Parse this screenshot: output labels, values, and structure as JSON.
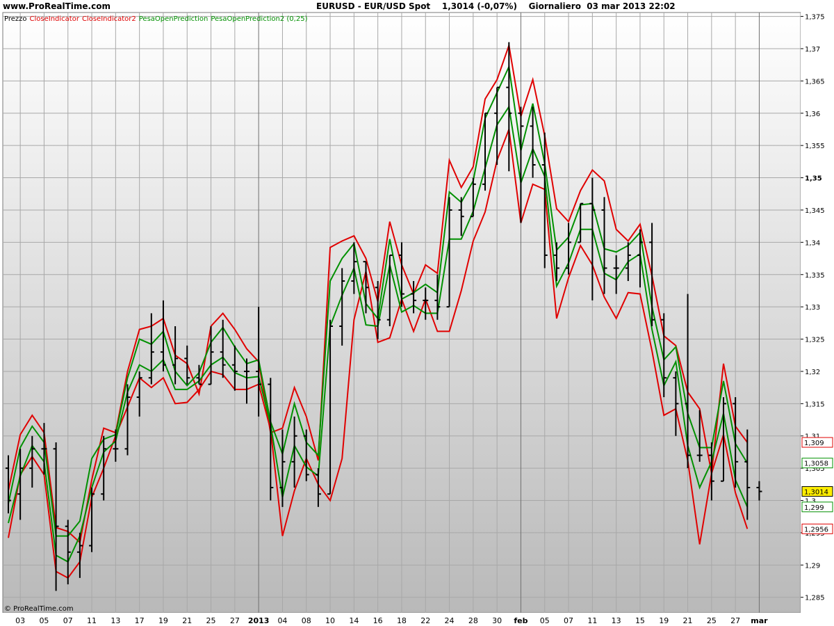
{
  "header": {
    "site": "www.ProRealTime.com",
    "title": "EURUSD - EUR/USD Spot    1,3014 (-0,07%)    Giornaliero  03 mar 2013 22:02"
  },
  "legend": {
    "items": [
      {
        "label": "Prezzo",
        "color": "#000000"
      },
      {
        "label": "CloseIndicator",
        "color": "#e00000"
      },
      {
        "label": "CloseIndicator2",
        "color": "#e00000"
      },
      {
        "label": "PesaOpenPrediction",
        "color": "#009000"
      },
      {
        "label": "PesaOpenPrediction2 (0,25)",
        "color": "#009000"
      }
    ]
  },
  "copyright": "© ProRealTime.com",
  "price_tags": [
    {
      "text": "1,309",
      "value": 1.309,
      "color": "#e00000",
      "bg": "#ffffff"
    },
    {
      "text": "1,3058",
      "value": 1.3058,
      "color": "#009000",
      "bg": "#ffffff"
    },
    {
      "text": "1,3014",
      "value": 1.3014,
      "color": "#000000",
      "bg": "#ffee00"
    },
    {
      "text": "1,299",
      "value": 1.299,
      "color": "#009000",
      "bg": "#ffffff"
    },
    {
      "text": "1,2956",
      "value": 1.2956,
      "color": "#e00000",
      "bg": "#ffffff"
    }
  ],
  "chart_data": {
    "type": "line",
    "y_ticks": [
      "1,375",
      "1,37",
      "1,365",
      "1,36",
      "1,355",
      "1,35",
      "1,345",
      "1,34",
      "1,335",
      "1,33",
      "1,325",
      "1,32",
      "1,315",
      "1,31",
      "1,305",
      "1,3",
      "1,295",
      "1,29",
      "1,285"
    ],
    "y_tick_values": [
      1.375,
      1.37,
      1.365,
      1.36,
      1.355,
      1.35,
      1.345,
      1.34,
      1.335,
      1.33,
      1.325,
      1.32,
      1.315,
      1.31,
      1.305,
      1.3,
      1.295,
      1.29,
      1.285
    ],
    "ylim": [
      1.2826,
      1.3756
    ],
    "grid": true,
    "x_labels": [
      "03",
      "05",
      "07",
      "11",
      "13",
      "17",
      "19",
      "21",
      "25",
      "27",
      "2013",
      "04",
      "08",
      "10",
      "14",
      "16",
      "18",
      "22",
      "24",
      "28",
      "30",
      "feb",
      "05",
      "07",
      "11",
      "13",
      "15",
      "19",
      "21",
      "25",
      "27",
      "mar"
    ],
    "x_label_index": [
      1,
      3,
      5,
      7,
      9,
      11,
      13,
      15,
      17,
      19,
      21,
      23,
      25,
      27,
      29,
      31,
      33,
      35,
      37,
      39,
      41,
      43,
      45,
      47,
      49,
      51,
      53,
      55,
      57,
      59,
      61,
      63
    ],
    "ohlc": [
      [
        1.305,
        1.307,
        1.298,
        1.3
      ],
      [
        1.301,
        1.308,
        1.297,
        1.305
      ],
      [
        1.305,
        1.31,
        1.302,
        1.308
      ],
      [
        1.308,
        1.312,
        1.304,
        1.308
      ],
      [
        1.308,
        1.309,
        1.286,
        1.296
      ],
      [
        1.296,
        1.297,
        1.287,
        1.292
      ],
      [
        1.292,
        1.295,
        1.288,
        1.293
      ],
      [
        1.293,
        1.302,
        1.292,
        1.301
      ],
      [
        1.301,
        1.31,
        1.3,
        1.308
      ],
      [
        1.308,
        1.311,
        1.306,
        1.308
      ],
      [
        1.308,
        1.318,
        1.307,
        1.316
      ],
      [
        1.316,
        1.32,
        1.313,
        1.319
      ],
      [
        1.319,
        1.329,
        1.318,
        1.323
      ],
      [
        1.323,
        1.331,
        1.32,
        1.321
      ],
      [
        1.321,
        1.327,
        1.318,
        1.322
      ],
      [
        1.322,
        1.324,
        1.318,
        1.319
      ],
      [
        1.319,
        1.321,
        1.318,
        1.318
      ],
      [
        1.318,
        1.327,
        1.318,
        1.323
      ],
      [
        1.323,
        1.328,
        1.319,
        1.321
      ],
      [
        1.321,
        1.324,
        1.317,
        1.32
      ],
      [
        1.32,
        1.322,
        1.315,
        1.32
      ],
      [
        1.32,
        1.33,
        1.313,
        1.318
      ],
      [
        1.318,
        1.319,
        1.3,
        1.302
      ],
      [
        1.302,
        1.311,
        1.299,
        1.306
      ],
      [
        1.306,
        1.313,
        1.302,
        1.31
      ],
      [
        1.31,
        1.311,
        1.303,
        1.304
      ],
      [
        1.304,
        1.305,
        1.299,
        1.301
      ],
      [
        1.301,
        1.328,
        1.301,
        1.327
      ],
      [
        1.327,
        1.336,
        1.324,
        1.334
      ],
      [
        1.334,
        1.34,
        1.332,
        1.337
      ],
      [
        1.337,
        1.337,
        1.329,
        1.333
      ],
      [
        1.333,
        1.334,
        1.325,
        1.328
      ],
      [
        1.328,
        1.338,
        1.327,
        1.338
      ],
      [
        1.338,
        1.34,
        1.33,
        1.332
      ],
      [
        1.332,
        1.334,
        1.329,
        1.331
      ],
      [
        1.331,
        1.333,
        1.328,
        1.331
      ],
      [
        1.331,
        1.335,
        1.328,
        1.33
      ],
      [
        1.33,
        1.347,
        1.33,
        1.345
      ],
      [
        1.345,
        1.347,
        1.341,
        1.344
      ],
      [
        1.344,
        1.35,
        1.344,
        1.349
      ],
      [
        1.349,
        1.36,
        1.348,
        1.36
      ],
      [
        1.36,
        1.364,
        1.352,
        1.364
      ],
      [
        1.364,
        1.371,
        1.351,
        1.36
      ],
      [
        1.36,
        1.361,
        1.343,
        1.358
      ],
      [
        1.358,
        1.361,
        1.35,
        1.352
      ],
      [
        1.352,
        1.357,
        1.336,
        1.338
      ],
      [
        1.338,
        1.34,
        1.334,
        1.336
      ],
      [
        1.336,
        1.343,
        1.335,
        1.34
      ],
      [
        1.34,
        1.346,
        1.34,
        1.346
      ],
      [
        1.346,
        1.35,
        1.331,
        1.345
      ],
      [
        1.345,
        1.347,
        1.332,
        1.336
      ],
      [
        1.336,
        1.338,
        1.332,
        1.336
      ],
      [
        1.336,
        1.34,
        1.334,
        1.338
      ],
      [
        1.338,
        1.342,
        1.333,
        1.34
      ],
      [
        1.34,
        1.343,
        1.327,
        1.328
      ],
      [
        1.328,
        1.329,
        1.316,
        1.319
      ],
      [
        1.319,
        1.32,
        1.31,
        1.315
      ],
      [
        1.315,
        1.332,
        1.305,
        1.307
      ],
      [
        1.307,
        1.314,
        1.306,
        1.307
      ],
      [
        1.307,
        1.309,
        1.3,
        1.303
      ],
      [
        1.303,
        1.316,
        1.303,
        1.315
      ],
      [
        1.315,
        1.316,
        1.302,
        1.306
      ],
      [
        1.306,
        1.311,
        1.297,
        1.302
      ],
      [
        1.302,
        1.303,
        1.3,
        1.3014
      ]
    ],
    "series": [
      {
        "name": "CloseIndicator",
        "color": "#e00000",
        "values": [
          1.3015,
          1.3102,
          1.3132,
          1.3105,
          1.2958,
          1.2952,
          1.2935,
          1.3032,
          1.3112,
          1.3105,
          1.32,
          1.3265,
          1.327,
          1.3282,
          1.3225,
          1.3212,
          1.3165,
          1.327,
          1.329,
          1.3265,
          1.3235,
          1.3215,
          1.3105,
          1.3112,
          1.3175,
          1.313,
          1.3062,
          1.3392,
          1.3402,
          1.341,
          1.3375,
          1.3308,
          1.3432,
          1.3365,
          1.332,
          1.3365,
          1.3352,
          1.3527,
          1.3485,
          1.3517,
          1.3622,
          1.3652,
          1.3705,
          1.3595,
          1.3652,
          1.3565,
          1.3452,
          1.3432,
          1.348,
          1.3512,
          1.3495,
          1.342,
          1.3402,
          1.3428,
          1.3348,
          1.3255,
          1.324,
          1.3168,
          1.3142,
          1.3042,
          1.3212,
          1.3115,
          1.309
        ]
      },
      {
        "name": "CloseIndicator2",
        "color": "#e00000",
        "values": [
          1.2942,
          1.304,
          1.3068,
          1.304,
          1.289,
          1.288,
          1.2905,
          1.3005,
          1.305,
          1.31,
          1.3145,
          1.319,
          1.3175,
          1.319,
          1.315,
          1.3152,
          1.3172,
          1.32,
          1.3195,
          1.3172,
          1.3172,
          1.318,
          1.311,
          1.2945,
          1.3015,
          1.3065,
          1.3025,
          1.3,
          1.3065,
          1.328,
          1.3355,
          1.3245,
          1.3252,
          1.3312,
          1.3262,
          1.3312,
          1.3262,
          1.3262,
          1.3325,
          1.3402,
          1.3447,
          1.3527,
          1.3575,
          1.343,
          1.349,
          1.3482,
          1.3282,
          1.3345,
          1.3395,
          1.3365,
          1.3315,
          1.3282,
          1.3322,
          1.332,
          1.3232,
          1.3132,
          1.3142,
          1.3062,
          1.2932,
          1.3042,
          1.3102,
          1.3012,
          1.2956
        ]
      },
      {
        "name": "PesaOpenPrediction",
        "color": "#009000",
        "values": [
          1.2995,
          1.3082,
          1.3115,
          1.309,
          1.2945,
          1.2945,
          1.2968,
          1.3065,
          1.3095,
          1.3102,
          1.319,
          1.325,
          1.3242,
          1.3262,
          1.32,
          1.3178,
          1.3198,
          1.3245,
          1.3268,
          1.3238,
          1.3212,
          1.3218,
          1.3122,
          1.3072,
          1.315,
          1.309,
          1.307,
          1.334,
          1.3375,
          1.3398,
          1.3305,
          1.3282,
          1.3405,
          1.3312,
          1.3322,
          1.3335,
          1.3322,
          1.3478,
          1.3462,
          1.3495,
          1.3592,
          1.3632,
          1.3672,
          1.3542,
          1.3615,
          1.3522,
          1.3388,
          1.3408,
          1.3458,
          1.346,
          1.339,
          1.3385,
          1.3395,
          1.3415,
          1.33,
          1.3218,
          1.3238,
          1.3135,
          1.3082,
          1.3082,
          1.3185,
          1.3088,
          1.3058
        ]
      },
      {
        "name": "PesaOpenPrediction2 (0,25)",
        "color": "#009000",
        "values": [
          1.2965,
          1.3038,
          1.3085,
          1.306,
          1.2915,
          1.2905,
          1.2945,
          1.302,
          1.3075,
          1.3092,
          1.3168,
          1.321,
          1.32,
          1.3218,
          1.3172,
          1.3172,
          1.3185,
          1.321,
          1.3222,
          1.3198,
          1.319,
          1.3192,
          1.3118,
          1.3005,
          1.3085,
          1.3052,
          1.3038,
          1.327,
          1.3318,
          1.336,
          1.3272,
          1.327,
          1.3365,
          1.3292,
          1.3302,
          1.329,
          1.329,
          1.3405,
          1.3405,
          1.3448,
          1.3515,
          1.3582,
          1.361,
          1.3492,
          1.3545,
          1.3502,
          1.3332,
          1.3368,
          1.342,
          1.342,
          1.3352,
          1.3342,
          1.337,
          1.3382,
          1.3265,
          1.3178,
          1.3215,
          1.3085,
          1.302,
          1.306,
          1.3135,
          1.3032,
          1.299
        ]
      }
    ]
  }
}
